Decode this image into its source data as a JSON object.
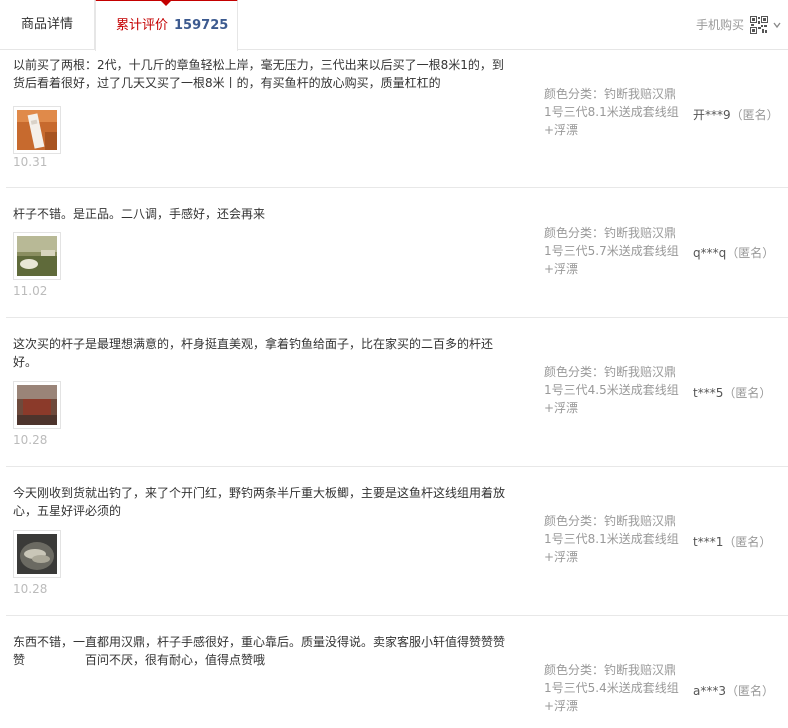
{
  "tabs": {
    "detail_label": "商品详情",
    "review_label": "累计评价",
    "review_count": "159725"
  },
  "mobile_buy_label": "手机购买",
  "icons": {
    "qr": "qr-code-icon",
    "caret": "chevron-down-icon"
  },
  "reviews": [
    {
      "text": "以前买了两根：2代，十几斤的章鱼轻松上岸，毫无压力，三代出来以后买了一根8米1的，到货后看着很好，过了几天又买了一根8米丨的，有买鱼杆的放心购买，质量杠杠的",
      "date": "10.31",
      "sku_label": "颜色分类：钓断我赔汉鼎",
      "sku_value": "1号三代8.1米送成套线组+浮漂",
      "user": "开***9",
      "anon": "（匿名）"
    },
    {
      "text": "杆子不错。是正品。二八调，手感好，还会再来",
      "date": "11.02",
      "sku_label": "颜色分类：钓断我赔汉鼎",
      "sku_value": "1号三代5.7米送成套线组+浮漂",
      "user": "q***q",
      "anon": "（匿名）"
    },
    {
      "text": "这次买的杆子是最理想满意的，杆身挺直美观，拿着钓鱼给面子，比在家买的二百多的杆还好。",
      "date": "10.28",
      "sku_label": "颜色分类：钓断我赔汉鼎",
      "sku_value": "1号三代4.5米送成套线组+浮漂",
      "user": "t***5",
      "anon": "（匿名）"
    },
    {
      "text": "今天刚收到货就出钓了，来了个开门红，野钓两条半斤重大板鲫，主要是这鱼杆这线组用着放心，五星好评必须的",
      "date": "10.28",
      "sku_label": "颜色分类：钓断我赔汉鼎",
      "sku_value": "1号三代8.1米送成套线组+浮漂",
      "user": "t***1",
      "anon": "（匿名）"
    },
    {
      "text": "东西不错，一直都用汉鼎，杆子手感很好，重心靠后。质量没得说。卖家客服小轩值得赞赞赞赞　　　　　百问不厌，很有耐心，值得点赞哦",
      "date": "",
      "sku_label": "颜色分类：钓断我赔汉鼎",
      "sku_value": "1号三代5.4米送成套线组+浮漂",
      "user": "a***3",
      "anon": "（匿名）"
    }
  ]
}
